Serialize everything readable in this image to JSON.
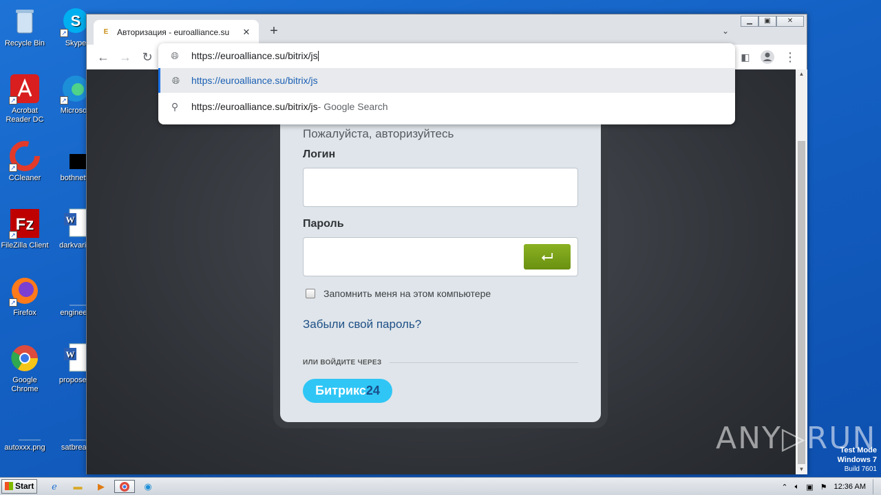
{
  "desktop": {
    "icons": [
      {
        "label": "Recycle Bin",
        "icon": "recycle-bin-icon"
      },
      {
        "label": "Skype",
        "icon": "skype-icon"
      },
      {
        "label": "Acrobat Reader DC",
        "icon": "acrobat-icon"
      },
      {
        "label": "Microsoft",
        "icon": "edge-icon"
      },
      {
        "label": "CCleaner",
        "icon": "ccleaner-icon"
      },
      {
        "label": "bothnetw",
        "icon": "black-file-icon"
      },
      {
        "label": "FileZilla Client",
        "icon": "filezilla-icon"
      },
      {
        "label": "darkvariel",
        "icon": "word-doc-icon"
      },
      {
        "label": "Firefox",
        "icon": "firefox-icon"
      },
      {
        "label": "engineeri",
        "icon": "blank-file-icon"
      },
      {
        "label": "Google Chrome",
        "icon": "chrome-icon"
      },
      {
        "label": "proposedl",
        "icon": "word-doc-icon"
      },
      {
        "label": "autoxxx.png",
        "icon": "image-file-icon"
      },
      {
        "label": "satbreak",
        "icon": "blank-file-icon"
      }
    ]
  },
  "browser": {
    "tab_title": "Авторизация - euroalliance.su",
    "tab_favicon": "E",
    "new_tab": "+",
    "url_text": "https://euroalliance.su/bitrix/js",
    "suggestions": [
      {
        "text": "https://euroalliance.su/bitrix/js",
        "suffix": ""
      },
      {
        "text": "https://euroalliance.su/bitrix/js",
        "suffix": " - Google Search"
      }
    ]
  },
  "login": {
    "subtitle": "Пожалуйста, авторизуйтесь",
    "login_label": "Логин",
    "password_label": "Пароль",
    "enter_glyph": "⮠",
    "remember_label": "Запомнить меня на этом компьютере",
    "forgot_link": "Забыли свой пароль?",
    "or_login_via": "ИЛИ ВОЙДИТЕ ЧЕРЕЗ",
    "bitrix_label": "Битрикс",
    "bitrix_num": "24"
  },
  "watermark": {
    "text": "ANY▷RUN",
    "mode": "Test Mode",
    "os": "Windows 7",
    "build": "Build 7601"
  },
  "taskbar": {
    "start_label": "Start",
    "clock": "12:36 AM"
  },
  "colors": {
    "accent": "#1a73e8",
    "enter_button": "#7aa21a",
    "bitrix": "#2fc6f6",
    "link": "#1d4f86"
  }
}
